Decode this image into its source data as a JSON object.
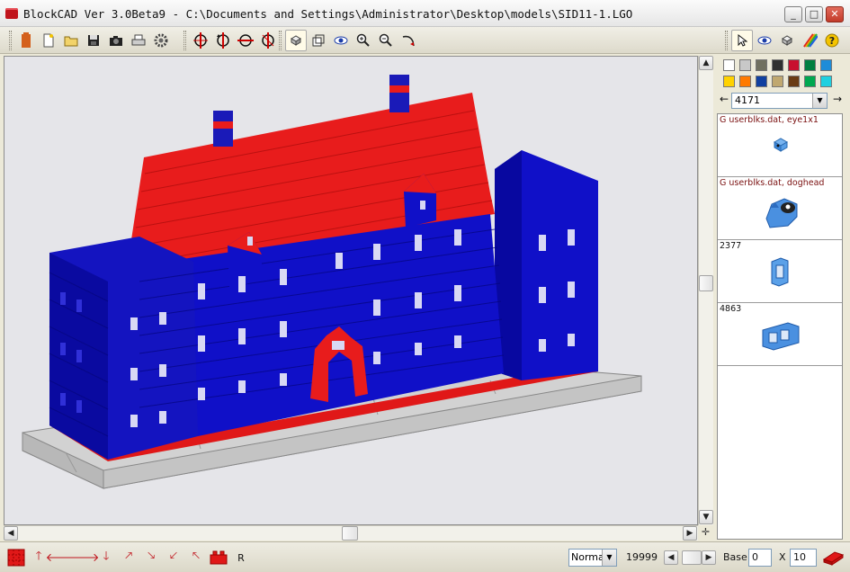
{
  "window": {
    "title": "BlockCAD Ver 3.0Beta9 - C:\\Documents and Settings\\Administrator\\Desktop\\models\\SID11-1.LGO",
    "minimize": "_",
    "maximize": "□",
    "close": "✕"
  },
  "toolbar": {
    "file_icons": [
      "brick-logo-icon",
      "new-file-icon",
      "open-folder-icon",
      "save-icon",
      "camera-icon",
      "print-icon",
      "settings-gear-icon"
    ],
    "rotate_icons": [
      "rotate-x-icon",
      "rotate-y-icon",
      "rotate-z-icon",
      "rotate-free-icon"
    ],
    "view_icons": [
      "single-brick-view-icon",
      "group-view-icon",
      "eye-view-icon",
      "zoom-in-icon",
      "zoom-out-icon",
      "rotate-view-icon"
    ],
    "panel_icons": [
      "pointer-icon",
      "eye-icon",
      "brick-icon",
      "rainbow-icon",
      "help-icon"
    ]
  },
  "palette": {
    "colors": [
      "#ffffff",
      "#c8c8c8",
      "#707060",
      "#303030",
      "#c8102e",
      "#008040",
      "#1e8cd8",
      "#ffd200",
      "#ff7a00",
      "#1040a0",
      "#c0a870",
      "#6a3c14",
      "#00a850",
      "#20d0e0"
    ]
  },
  "part_selector": {
    "prev": "←",
    "next": "→",
    "value": "4171"
  },
  "parts": [
    {
      "label": "G userblks.dat, eye1x1",
      "kind": "eye"
    },
    {
      "label": "G userblks.dat, doghead",
      "kind": "dog"
    },
    {
      "label": "2377",
      "kind": "window"
    },
    {
      "label": "4863",
      "kind": "panel"
    }
  ],
  "status": {
    "mode": "Norma",
    "counter": "19999",
    "base_label": "Base:",
    "base_value": "0",
    "x_label": "X",
    "x_value": "10",
    "raise_label": "R"
  }
}
